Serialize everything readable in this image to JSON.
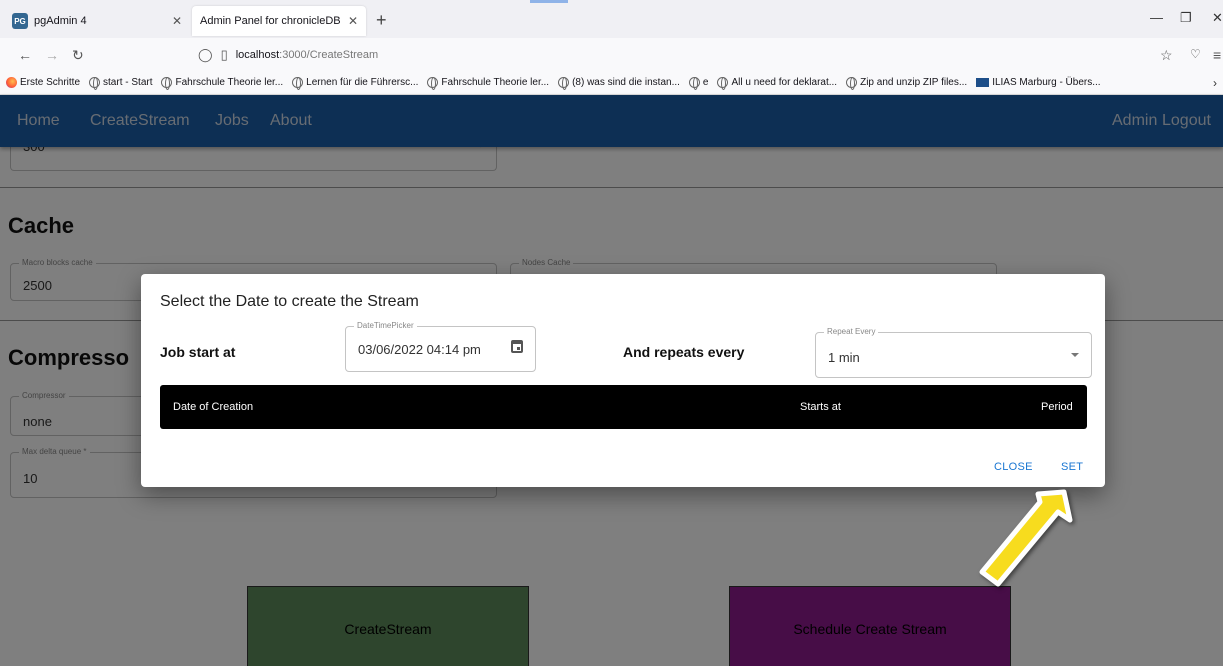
{
  "browser": {
    "tabs": [
      {
        "icon": "PG",
        "title": "pgAdmin 4"
      },
      {
        "title": "Admin Panel for chronicleDB"
      }
    ],
    "new_tab": "+",
    "url_host": "localhost",
    "url_path": ":3000/CreateStream",
    "bookmarks": [
      "Erste Schritte",
      "start - Start",
      "Fahrschule Theorie ler...",
      "Lernen für die Führersc...",
      "Fahrschule Theorie ler...",
      "(8) was sind die instan...",
      "e",
      "All u need for deklarat...",
      "Zip and unzip ZIP files...",
      "ILIAS Marburg - Übers..."
    ]
  },
  "app": {
    "nav_left": [
      "Home",
      "CreateStream",
      "Jobs",
      "About"
    ],
    "nav_right": [
      "Admin",
      "Logout"
    ]
  },
  "form": {
    "top_value": "300",
    "cache_heading": "Cache",
    "macro_blocks_label": "Macro blocks cache",
    "macro_blocks_value": "2500",
    "nodes_cache_label": "Nodes Cache",
    "compressor_heading": "Compresso",
    "compressor_label": "Compressor",
    "compressor_value": "none",
    "max_delta_label": "Max delta queue *",
    "max_delta_value": "10",
    "create_stream_button": "CreateStream",
    "schedule_button": "Schedule Create Stream"
  },
  "dialog": {
    "title": "Select the Date to create the Stream",
    "job_start_label": "Job start at",
    "date_picker_label": "DateTimePicker",
    "date_value": "03/06/2022 04:14 pm",
    "repeats_label": "And repeats every",
    "repeat_field_label": "Repeat Every",
    "repeat_value": "1 min",
    "table_headers": [
      "Date of Creation",
      "Starts at",
      "Period"
    ],
    "close_label": "CLOSE",
    "set_label": "SET"
  },
  "colors": {
    "appbar": "#1a5fa8",
    "create_btn": "#5c8a5a",
    "schedule_btn": "#8e1a8e",
    "arrow": "#f7dc1e",
    "action": "#1976d2"
  }
}
